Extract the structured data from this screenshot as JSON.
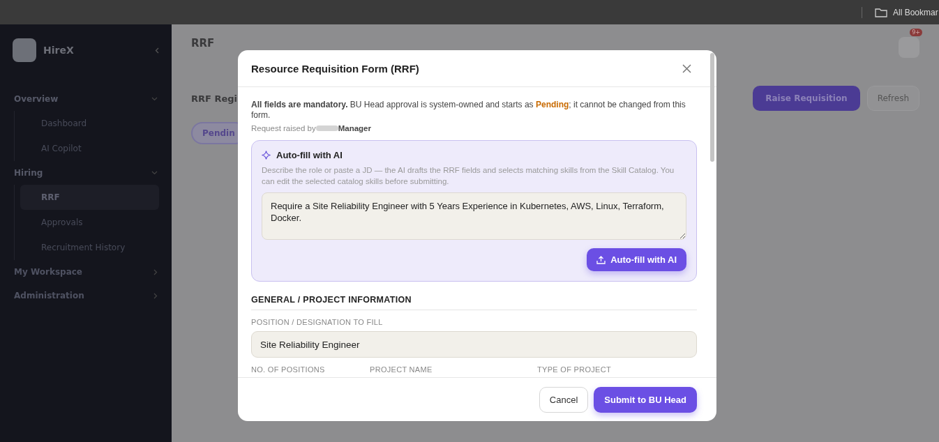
{
  "browser_bar": {
    "bookmarks_label": "All Bookmar"
  },
  "sidebar": {
    "brand": "HireX",
    "groups": [
      {
        "label": "Overview",
        "expanded": true,
        "items": [
          {
            "label": "Dashboard",
            "selected": false
          },
          {
            "label": "AI Copilot",
            "selected": false
          }
        ]
      },
      {
        "label": "Hiring",
        "expanded": true,
        "items": [
          {
            "label": "RRF",
            "selected": true
          },
          {
            "label": "Approvals",
            "selected": false
          },
          {
            "label": "Recruitment History",
            "selected": false
          }
        ]
      },
      {
        "label": "My Workspace",
        "expanded": false
      },
      {
        "label": "Administration",
        "expanded": false
      }
    ]
  },
  "page": {
    "title": "RRF",
    "section_title": "RRF Regi",
    "filter_tab": "Pendin",
    "primary_button": "Raise Requisition",
    "refresh_button": "Refresh",
    "notification_count": "9+"
  },
  "modal": {
    "title": "Resource Requisition Form (RRF)",
    "notice": "**All fields are mandatory.** BU Head approval is system-owned and starts as ",
    "notice_status": "Pending",
    "notice_end": "; it cannot be changed from this form.",
    "raised_by_label": "Request raised by",
    "raised_by_role": "Manager",
    "autofill": {
      "title": "Auto-fill with AI",
      "description": "Describe the role or paste a JD — the AI drafts the RRF fields and selects matching skills from the Skill Catalog. You can edit the selected catalog skills before submitting.",
      "prompt": "Require a Site Reliability Engineer with 5 Years Experience in Kubernetes, AWS, Linux, Terraform, Docker.",
      "button": "Auto-fill with AI"
    },
    "section": "GENERAL / PROJECT INFORMATION",
    "position_label": "POSITION / DESIGNATION TO FILL",
    "position_value": "Site Reliability Engineer",
    "row_labels": [
      "NO. OF POSITIONS",
      "PROJECT NAME",
      "TYPE OF PROJECT"
    ],
    "buttons": [
      {
        "label": "Cancel",
        "kind": "secondary"
      },
      {
        "label": "Submit to BU Head",
        "kind": "primary"
      }
    ]
  }
}
